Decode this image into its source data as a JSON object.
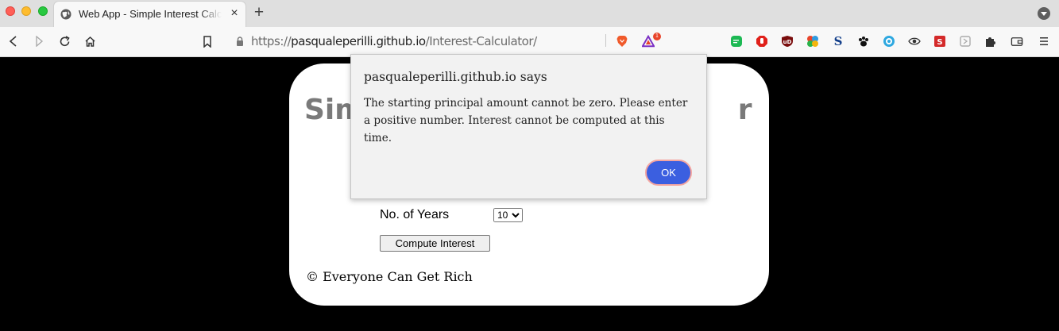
{
  "browser": {
    "tab_title": "Web App - Simple Interest Calculator",
    "tab_close": "×",
    "new_tab": "+",
    "url_scheme": "https://",
    "url_host": "pasqualeperilli.github.io",
    "url_path": "/Interest-Calculator/",
    "notification_badge": "1",
    "extensions": [
      "chat-icon",
      "stop-icon",
      "ublock-icon",
      "colorful-icon",
      "s-icon",
      "paw-icon",
      "circle-icon",
      "eye-icon",
      "red-square-icon",
      "square-outline-icon",
      "puzzle-icon",
      "wallet-icon"
    ]
  },
  "page": {
    "title_visible_left": "Sim",
    "title_visible_right": "r",
    "years_label": "No. of Years",
    "years_selected": "10",
    "compute_button": "Compute Interest",
    "footer": "© Everyone Can Get Rich"
  },
  "dialog": {
    "title": "pasqualeperilli.github.io says",
    "message": "The starting principal amount cannot be zero. Please enter a positive number. Interest cannot be computed at this time.",
    "ok_label": "OK"
  },
  "colors": {
    "ok_button": "#3b5fe0",
    "card_background": "#ffffff",
    "page_background": "#000000",
    "title_gray": "#7a7a7a"
  }
}
